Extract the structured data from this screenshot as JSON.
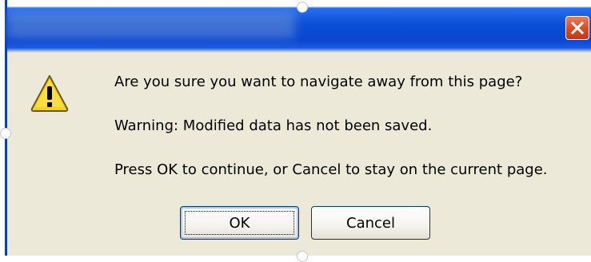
{
  "dialog": {
    "title": "",
    "close_icon": "close-icon",
    "warning_icon": "warning-icon",
    "messages": [
      "Are you sure you want to navigate away from this page?",
      "Warning: Modified data has not been saved.",
      "Press OK to continue, or Cancel to stay on the current page."
    ],
    "buttons": {
      "ok_label": "OK",
      "cancel_label": "Cancel"
    }
  },
  "colors": {
    "titlebar": "#0a46d0",
    "dialog_background": "#ece9d8",
    "close_button": "#d84a22",
    "warning_fill": "#f5d020"
  }
}
